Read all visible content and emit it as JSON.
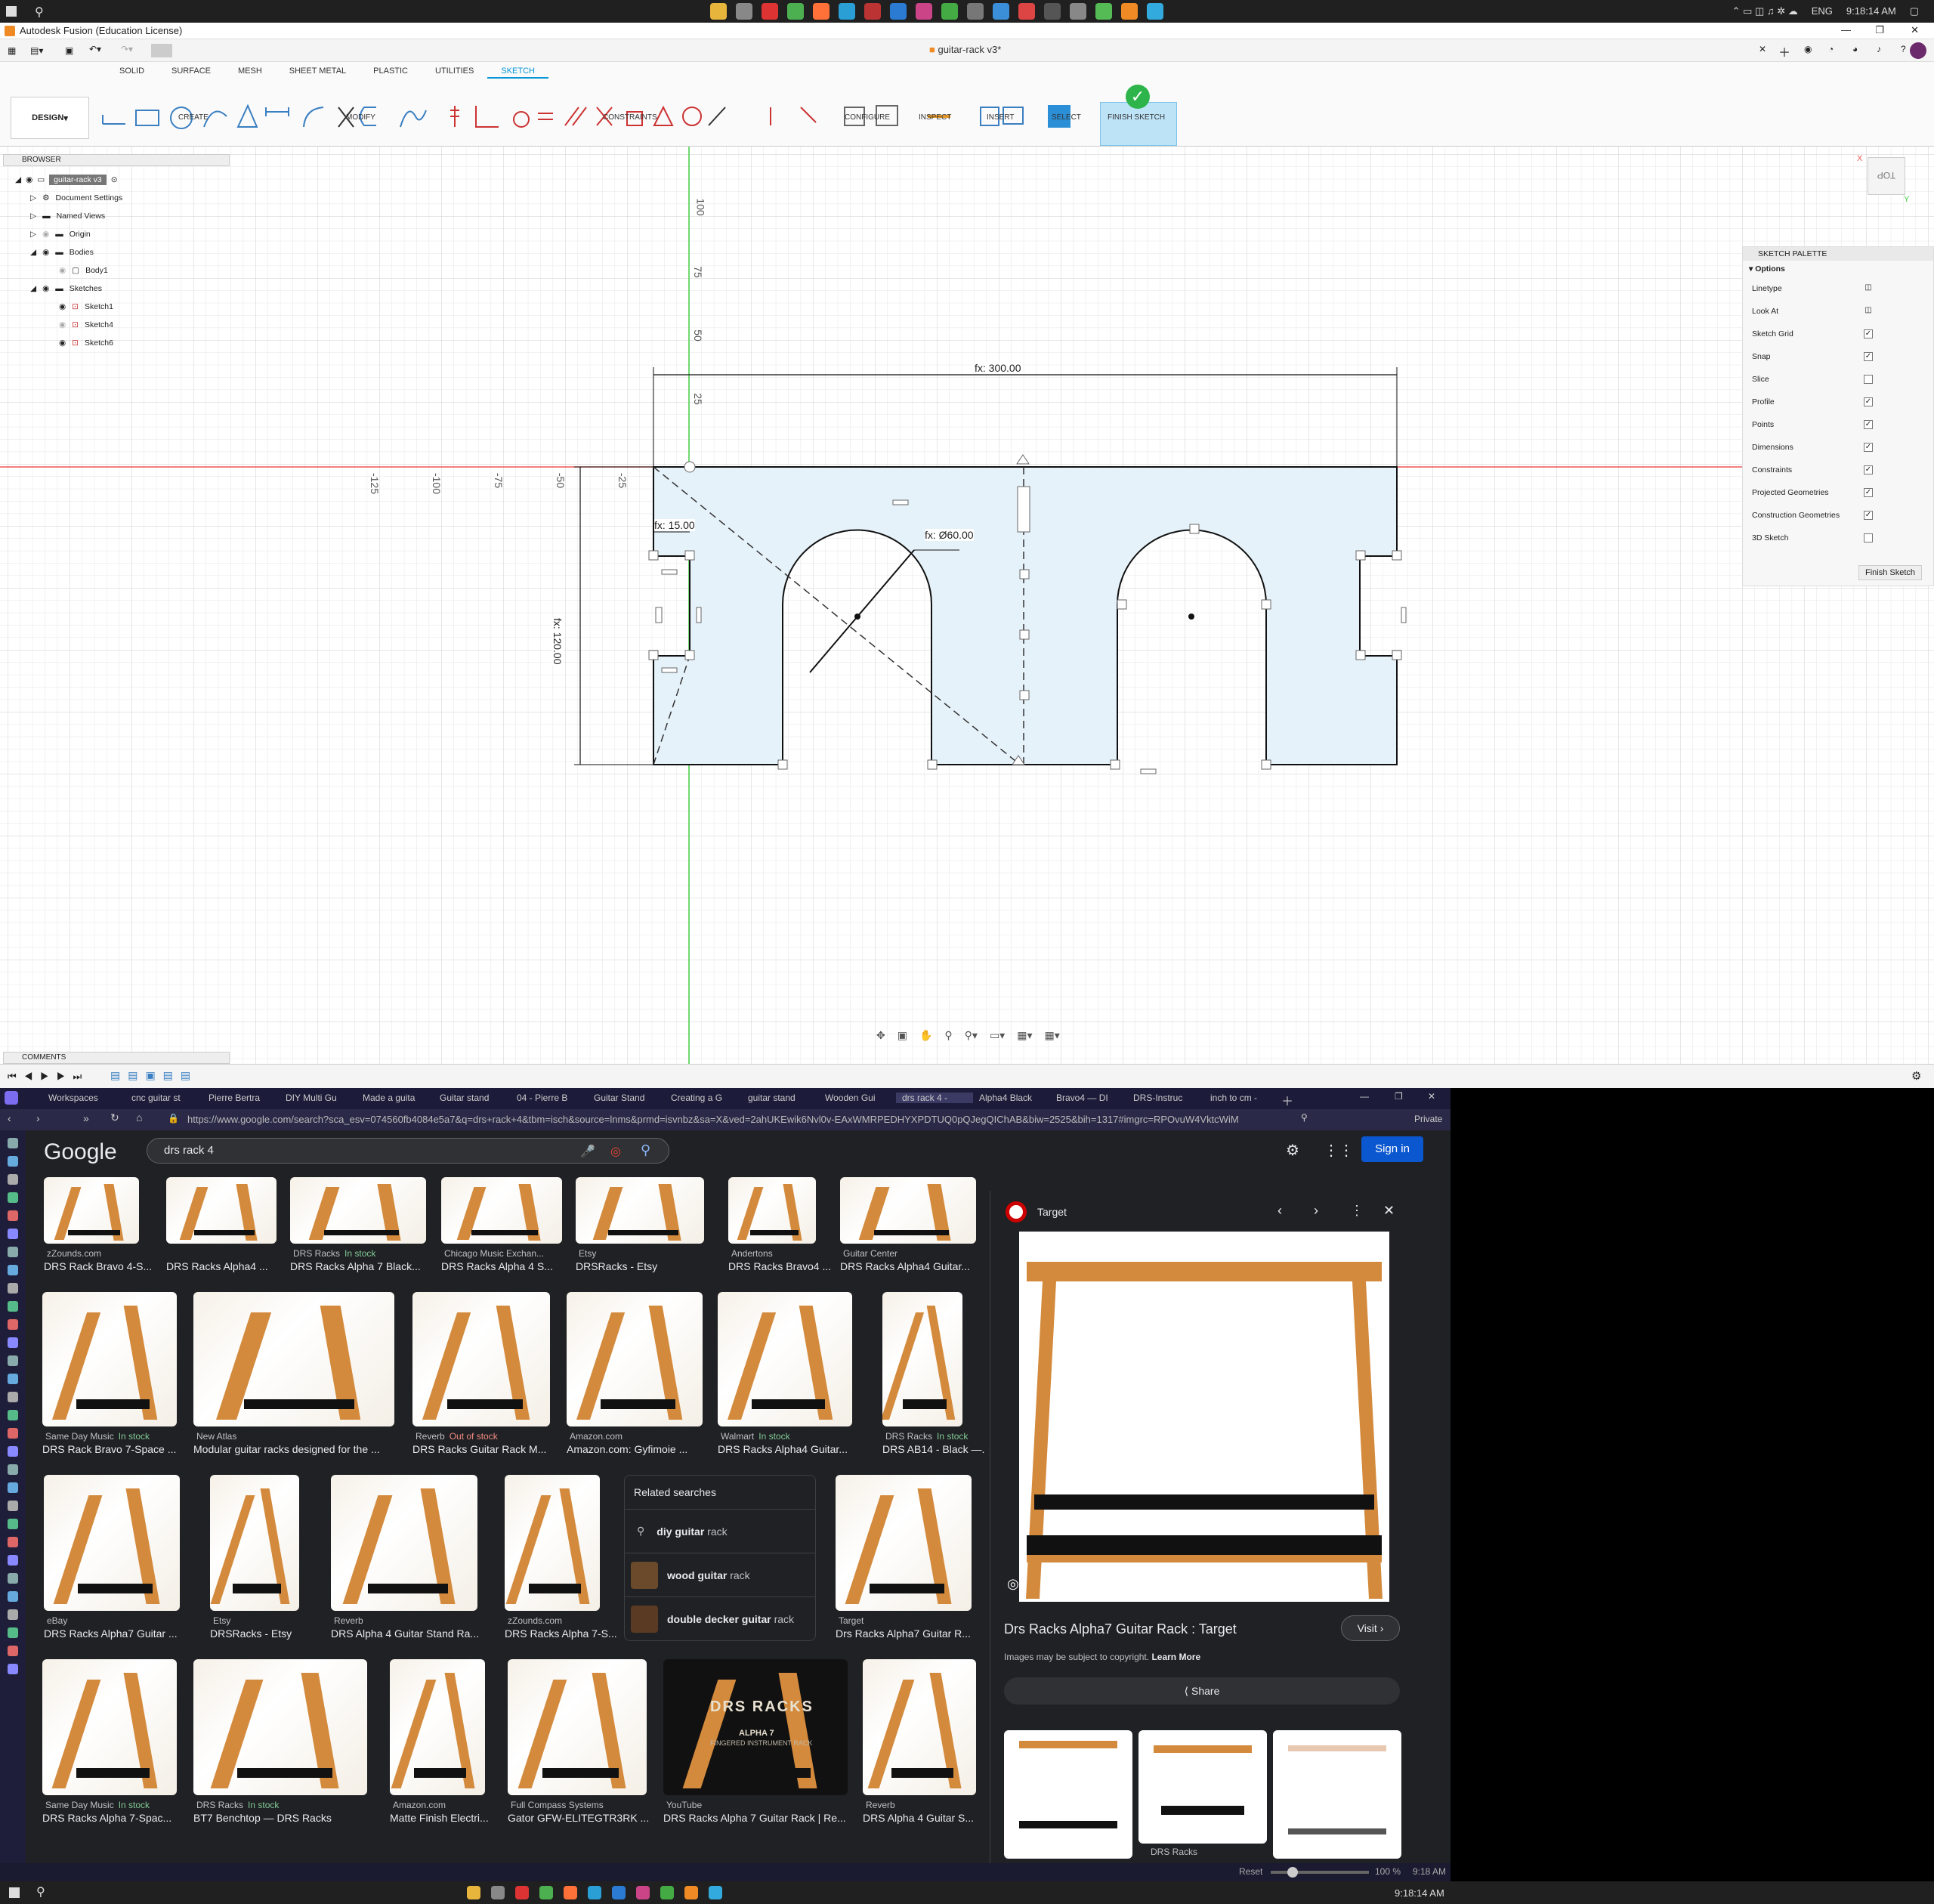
{
  "taskbar_top": {
    "lang": "ENG",
    "time": "9:18:14 AM"
  },
  "fusion": {
    "window_title": "Autodesk Fusion (Education License)",
    "doc_tab": "guitar-rack v3*",
    "tabs": [
      "SOLID",
      "SURFACE",
      "MESH",
      "SHEET METAL",
      "PLASTIC",
      "UTILITIES",
      "SKETCH"
    ],
    "design_label": "DESIGN",
    "groups": {
      "create": "CREATE",
      "modify": "MODIFY",
      "constraints": "CONSTRAINTS",
      "configure": "CONFIGURE",
      "inspect": "INSPECT",
      "insert": "INSERT",
      "select": "SELECT",
      "finish": "FINISH SKETCH"
    },
    "browser": {
      "title": "BROWSER",
      "root": "guitar-rack v3",
      "items": [
        "Document Settings",
        "Named Views",
        "Origin",
        "Bodies",
        "Body1",
        "Sketches",
        "Sketch1",
        "Sketch4",
        "Sketch6"
      ]
    },
    "palette": {
      "title": "SKETCH PALETTE",
      "options_label": "Options",
      "rows": [
        {
          "label": "Linetype",
          "checked": null
        },
        {
          "label": "Look At",
          "checked": null
        },
        {
          "label": "Sketch Grid",
          "checked": true
        },
        {
          "label": "Snap",
          "checked": true
        },
        {
          "label": "Slice",
          "checked": false
        },
        {
          "label": "Profile",
          "checked": true
        },
        {
          "label": "Points",
          "checked": true
        },
        {
          "label": "Dimensions",
          "checked": true
        },
        {
          "label": "Constraints",
          "checked": true
        },
        {
          "label": "Projected Geometries",
          "checked": true
        },
        {
          "label": "Construction Geometries",
          "checked": true
        },
        {
          "label": "3D Sketch",
          "checked": false
        }
      ],
      "finish_label": "Finish Sketch"
    },
    "comments": "COMMENTS",
    "viewcube": "TOP",
    "sketch": {
      "dim_width": "fx: 300.00",
      "dim_height": "fx: 120.00",
      "dim_offset": "fx: 15.00",
      "dim_diameter": "fx: Ø60.00",
      "axis_labels_y": [
        "100",
        "75",
        "50",
        "25"
      ],
      "axis_labels_x": [
        "-125",
        "-100",
        "-75",
        "-50",
        "-25"
      ]
    }
  },
  "browser_win": {
    "tabs": [
      "Workspaces",
      "cnc guitar st",
      "Pierre Bertra",
      "DIY Multi Gu",
      "Made a guita",
      "Guitar stand",
      "04 - Pierre B",
      "Guitar Stand",
      "Creating a G",
      "guitar stand",
      "Wooden Gui",
      "drs rack 4 -",
      "Alpha4 Black",
      "Bravo4 — DI",
      "DRS-Instruc",
      "inch to cm -"
    ],
    "url": "https://www.google.com/search?sca_esv=074560fb4084e5a7&q=drs+rack+4&tbm=isch&source=lnms&prmd=isvnbz&sa=X&ved=2ahUKEwik6Nvl0v-EAxWMRPEDHYXPDTUQ0pQJegQIChAB&biw=2525&bih=1317#imgrc=RPOvuW4VktcWiM",
    "private": "Private",
    "google": {
      "logo": "Google",
      "query": "drs rack 4",
      "signin": "Sign in"
    },
    "row0": [
      {
        "src": "zZounds.com",
        "stock": "",
        "cap": "DRS Rack Bravo 4-S..."
      },
      {
        "src": "",
        "stock": "",
        "cap": "DRS Racks Alpha4 ..."
      },
      {
        "src": "DRS Racks",
        "stock": "In stock",
        "cap": "DRS Racks Alpha 7 Black..."
      },
      {
        "src": "Chicago Music Exchan...",
        "stock": "",
        "cap": "DRS Racks Alpha 4 S..."
      },
      {
        "src": "Etsy",
        "stock": "",
        "cap": "DRSRacks - Etsy"
      },
      {
        "src": "Andertons",
        "stock": "",
        "cap": "DRS Racks Bravo4 ..."
      },
      {
        "src": "Guitar Center",
        "stock": "",
        "cap": "DRS Racks Alpha4 Guitar..."
      }
    ],
    "row0_extra_src": "Andertons",
    "row1": [
      {
        "src": "Same Day Music",
        "stock": "In stock",
        "cap": "DRS Rack Bravo 7-Space ..."
      },
      {
        "src": "New Atlas",
        "stock": "",
        "cap": "Modular guitar racks designed for the ..."
      },
      {
        "src": "Reverb",
        "stock": "Out of stock",
        "cap": "DRS Racks Guitar Rack M..."
      },
      {
        "src": "Amazon.com",
        "stock": "",
        "cap": "Amazon.com: Gyfimoie ..."
      },
      {
        "src": "Walmart",
        "stock": "In stock",
        "cap": "DRS Racks Alpha4 Guitar..."
      },
      {
        "src": "DRS Racks",
        "stock": "In stock",
        "cap": "DRS AB14 - Black —..."
      }
    ],
    "row2": [
      {
        "src": "eBay",
        "stock": "",
        "cap": "DRS Racks Alpha7 Guitar ..."
      },
      {
        "src": "Etsy",
        "stock": "",
        "cap": "DRSRacks - Etsy"
      },
      {
        "src": "Reverb",
        "stock": "",
        "cap": "DRS Alpha 4 Guitar Stand Ra..."
      },
      {
        "src": "zZounds.com",
        "stock": "",
        "cap": "DRS Racks Alpha 7-S..."
      },
      {
        "src": "Target",
        "stock": "",
        "cap": "Drs Racks Alpha7 Guitar R..."
      }
    ],
    "related": {
      "title": "Related searches",
      "items": [
        {
          "bold": "diy guitar",
          "rest": " rack"
        },
        {
          "bold": "wood guitar",
          "rest": " rack"
        },
        {
          "bold": "double decker guitar",
          "rest": " rack"
        }
      ]
    },
    "row3": [
      {
        "src": "Same Day Music",
        "stock": "In stock",
        "cap": "DRS Racks Alpha 7-Spac..."
      },
      {
        "src": "DRS Racks",
        "stock": "In stock",
        "cap": "BT7 Benchtop — DRS Racks"
      },
      {
        "src": "Amazon.com",
        "stock": "",
        "cap": "Matte Finish Electri..."
      },
      {
        "src": "Full Compass Systems",
        "stock": "",
        "cap": "Gator GFW-ELITEGTR3RK ..."
      },
      {
        "src": "YouTube",
        "stock": "",
        "cap": "DRS Racks Alpha 7 Guitar Rack | Re..."
      },
      {
        "src": "Reverb",
        "stock": "",
        "cap": "DRS Alpha 4 Guitar S..."
      }
    ],
    "drs_banner": {
      "title": "DRS RACKS",
      "sub": "ALPHA 7",
      "sub2": "FINGERED INSTRUMENT RACK"
    },
    "preview": {
      "source": "Target",
      "title": "Drs Racks Alpha7 Guitar Rack : Target",
      "visit": "Visit",
      "copyright": "Images may be subject to copyright.",
      "learn": "Learn More",
      "share": "Share",
      "related_src": "DRS Racks"
    },
    "status": {
      "reset": "Reset",
      "zoom": "100 %",
      "time": "9:18 AM"
    }
  },
  "taskbar_bottom": {
    "time": "9:18:14 AM"
  },
  "colors": {
    "accent": "#0696d7",
    "sketch_fill": "#e6f2fa",
    "finish": "#2db44a",
    "google_blue": "#0b57d0",
    "wood": "#d48a3c"
  }
}
